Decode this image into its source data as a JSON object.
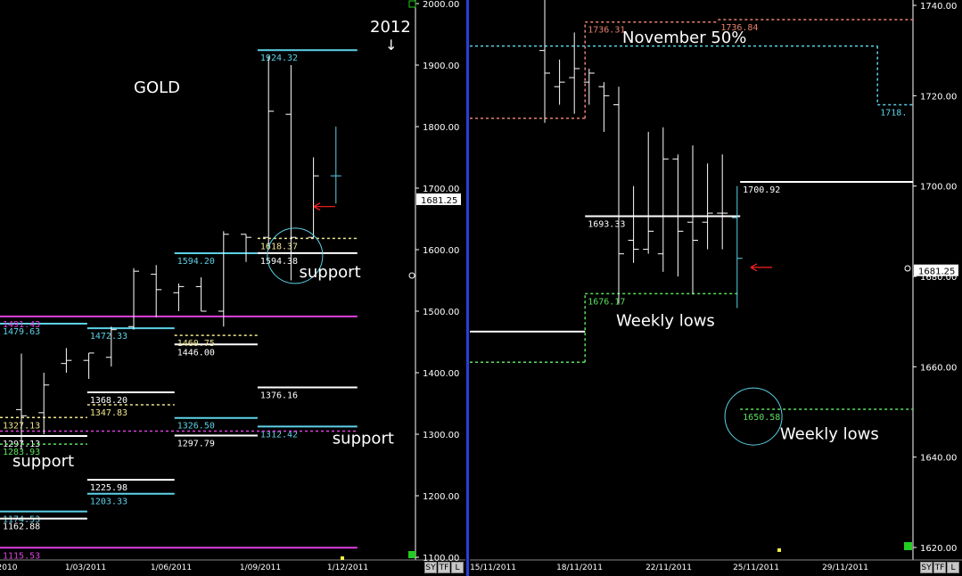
{
  "chart_data": [
    {
      "type": "bar",
      "style": "ohlc-monthly",
      "title": "GOLD",
      "annotation_year": "2012",
      "annotation_arrow": "↓",
      "ylim": [
        1100,
        2000
      ],
      "y_ticks": [
        "2000.00",
        "1900.00",
        "1800.00",
        "1700.00",
        "1600.00",
        "1500.00",
        "1400.00",
        "1300.00",
        "1200.00",
        "1100.00"
      ],
      "x_ticks": [
        "2010",
        "1/03/2011",
        "1/06/2011",
        "1/09/2011",
        "1/12/2011"
      ],
      "current_price": "1681.25",
      "price_color": "#ffffff",
      "bars": [
        {
          "h": 1431,
          "l": 1275,
          "o": 1340,
          "c": 1330
        },
        {
          "h": 1400,
          "l": 1300,
          "o": 1335,
          "c": 1380
        },
        {
          "h": 1440,
          "l": 1400,
          "o": 1415,
          "c": 1420
        },
        {
          "h": 1432,
          "l": 1390,
          "o": 1420,
          "c": 1432
        },
        {
          "h": 1475,
          "l": 1410,
          "o": 1425,
          "c": 1470
        },
        {
          "h": 1570,
          "l": 1470,
          "o": 1475,
          "c": 1565
        },
        {
          "h": 1575,
          "l": 1490,
          "o": 1560,
          "c": 1535
        },
        {
          "h": 1545,
          "l": 1500,
          "o": 1530,
          "c": 1540
        },
        {
          "h": 1555,
          "l": 1500,
          "o": 1540,
          "c": 1500
        },
        {
          "h": 1630,
          "l": 1475,
          "o": 1500,
          "c": 1625
        },
        {
          "h": 1625,
          "l": 1580,
          "o": 1625,
          "c": 1620
        },
        {
          "h": 1915,
          "l": 1600,
          "o": 1620,
          "c": 1825
        },
        {
          "h": 1900,
          "l": 1550,
          "o": 1820,
          "c": 1620
        },
        {
          "h": 1750,
          "l": 1620,
          "o": 1620,
          "c": 1720
        },
        {
          "h": 1800,
          "l": 1675,
          "o": 1720,
          "c": 1720
        }
      ],
      "levels": [
        {
          "label": "1924.32",
          "color": "#5cd2e8",
          "style": "solid",
          "segments": [
            [
              1924.32,
              0.62,
              0.86
            ]
          ]
        },
        {
          "label": "1594.20",
          "color": "#5cd2e8",
          "style": "solid",
          "segments": [
            [
              1594.2,
              0.42,
              0.62
            ]
          ]
        },
        {
          "label": "1472.33",
          "color": "#5cd2e8",
          "style": "solid",
          "segments": [
            [
              1472.33,
              0.21,
              0.42
            ]
          ]
        },
        {
          "label": "1479.63",
          "color": "#5cd2e8",
          "style": "solid",
          "segments": [
            [
              1479.63,
              0.0,
              0.21
            ]
          ]
        },
        {
          "label": "1203.33",
          "color": "#5cd2e8",
          "style": "solid",
          "segments": [
            [
              1203.33,
              0.21,
              0.42
            ]
          ]
        },
        {
          "label": "1326.50",
          "color": "#5cd2e8",
          "style": "solid",
          "segments": [
            [
              1326.5,
              0.42,
              0.62
            ]
          ]
        },
        {
          "label": "1312.42",
          "color": "#5cd2e8",
          "style": "solid",
          "segments": [
            [
              1312.42,
              0.62,
              0.86
            ]
          ]
        },
        {
          "label": "1174.53",
          "color": "#5cd2e8",
          "style": "solid",
          "segments": [
            [
              1174.53,
              0.0,
              0.21
            ]
          ]
        },
        {
          "label": "1594.38",
          "color": "#ffffff",
          "style": "solid",
          "segments": [
            [
              1594.38,
              0.62,
              0.86
            ]
          ]
        },
        {
          "label": "1376.16",
          "color": "#ffffff",
          "style": "solid",
          "segments": [
            [
              1376.16,
              0.62,
              0.86
            ]
          ]
        },
        {
          "label": "1446.00",
          "color": "#ffffff",
          "style": "solid",
          "segments": [
            [
              1446,
              0.42,
              0.62
            ]
          ]
        },
        {
          "label": "1368.20",
          "color": "#ffffff",
          "style": "solid",
          "segments": [
            [
              1368.2,
              0.21,
              0.42
            ]
          ]
        },
        {
          "label": "1297.79",
          "color": "#ffffff",
          "style": "solid",
          "segments": [
            [
              1297.79,
              0.42,
              0.62
            ]
          ]
        },
        {
          "label": "1225.98",
          "color": "#ffffff",
          "style": "solid",
          "segments": [
            [
              1225.98,
              0.21,
              0.42
            ]
          ]
        },
        {
          "label": "1162.88",
          "color": "#ffffff",
          "style": "solid",
          "segments": [
            [
              1162.88,
              0.0,
              0.21
            ]
          ]
        },
        {
          "label": "1297.13",
          "color": "#ffffff",
          "style": "solid",
          "segments": [
            [
              1297.13,
              0.0,
              0.21
            ]
          ]
        },
        {
          "label": "1618.37",
          "color": "#f0e68c",
          "style": "dashed",
          "segments": [
            [
              1618.37,
              0.62,
              0.86
            ]
          ]
        },
        {
          "label": "1460.75",
          "color": "#f0e68c",
          "style": "dashed",
          "segments": [
            [
              1460.75,
              0.42,
              0.62
            ]
          ]
        },
        {
          "label": "1347.83",
          "color": "#f0e68c",
          "style": "dashed",
          "segments": [
            [
              1347.83,
              0.21,
              0.42
            ]
          ]
        },
        {
          "label": "1327.13",
          "color": "#f0e68c",
          "style": "dashed",
          "segments": [
            [
              1327.13,
              0.0,
              0.21
            ]
          ]
        },
        {
          "label": "1491.43",
          "color": "#e040e0",
          "style": "solid",
          "segments": [
            [
              1491.43,
              0.0,
              0.86
            ]
          ]
        },
        {
          "label": "1115.53",
          "color": "#e040e0",
          "style": "solid",
          "segments": [
            [
              1115.53,
              0.0,
              0.86
            ]
          ]
        },
        {
          "label": "1283.93",
          "color": "#5ce05c",
          "style": "dashed",
          "segments": [
            [
              1283.93,
              0.0,
              0.21
            ]
          ]
        },
        {
          "label": "",
          "color": "#e040e0",
          "style": "dashed",
          "segments": [
            [
              1305,
              0.0,
              0.86
            ]
          ]
        }
      ],
      "annotations": [
        {
          "text": "support",
          "v": 1555,
          "xf": 0.72
        },
        {
          "text": "support",
          "v": 1285,
          "xf": 0.8
        },
        {
          "text": "support",
          "v": 1248,
          "xf": 0.03
        }
      ],
      "circle": {
        "v": 1590,
        "xf": 0.71
      },
      "arrow": {
        "v": 1670
      }
    },
    {
      "type": "bar",
      "style": "ohlc-daily",
      "title": "November 50%",
      "annotation_year": "",
      "annotation_arrow": "",
      "ylim": [
        1620,
        1740
      ],
      "y_ticks": [
        "1740.00",
        "1720.00",
        "1700.00",
        "1680.00",
        "1660.00",
        "1640.00",
        "1620.00"
      ],
      "x_ticks": [
        "15/11/2011",
        "18/11/2011",
        "22/11/2011",
        "25/11/2011",
        "29/11/2011"
      ],
      "current_price": "1681.25",
      "price_color": "#ffffff",
      "bars": [
        {
          "h": 1745,
          "l": 1714,
          "o": 1730,
          "c": 1725
        },
        {
          "h": 1728,
          "l": 1718,
          "o": 1722,
          "c": 1723
        },
        {
          "h": 1734,
          "l": 1716,
          "o": 1724,
          "c": 1726
        },
        {
          "h": 1726,
          "l": 1718,
          "o": 1723,
          "c": 1725
        },
        {
          "h": 1723,
          "l": 1712,
          "o": 1722,
          "c": 1720
        },
        {
          "h": 1722,
          "l": 1674,
          "o": 1718,
          "c": 1685
        },
        {
          "h": 1700,
          "l": 1683,
          "o": 1688,
          "c": 1686
        },
        {
          "h": 1712,
          "l": 1685,
          "o": 1686,
          "c": 1690
        },
        {
          "h": 1713,
          "l": 1681,
          "o": 1685,
          "c": 1706
        },
        {
          "h": 1707,
          "l": 1680,
          "o": 1706,
          "c": 1690
        },
        {
          "h": 1709,
          "l": 1676,
          "o": 1692,
          "c": 1688
        },
        {
          "h": 1705,
          "l": 1686,
          "o": 1692,
          "c": 1694
        },
        {
          "h": 1707,
          "l": 1686,
          "o": 1694,
          "c": 1694
        },
        {
          "h": 1700,
          "l": 1673,
          "o": 1693,
          "c": 1684
        }
      ],
      "levels": [
        {
          "label": "1736.31",
          "color": "#e8826e",
          "style": "dashed",
          "segments": [
            [
              1715,
              0.0,
              0.26
            ],
            [
              1736.31,
              0.26,
              0.56
            ]
          ]
        },
        {
          "label": "1736.84",
          "color": "#e8826e",
          "style": "dashed",
          "segments": [
            [
              1736.84,
              0.56,
              1.0
            ]
          ]
        },
        {
          "label": "1718.",
          "color": "#5cd2e8",
          "style": "dashed",
          "segments": [
            [
              1731,
              0.0,
              0.92
            ],
            [
              1718,
              0.92,
              1.0
            ]
          ]
        },
        {
          "label": "1700.92",
          "color": "#ffffff",
          "style": "solid",
          "segments": [
            [
              1700.92,
              0.61,
              1.0
            ]
          ]
        },
        {
          "label": "1693.33",
          "color": "#ffffff",
          "style": "solid",
          "segments": [
            [
              1693.33,
              0.26,
              0.61
            ]
          ]
        },
        {
          "label": "",
          "color": "#ffffff",
          "style": "solid",
          "segments": [
            [
              1667.8,
              0.0,
              0.26
            ]
          ]
        },
        {
          "label": "1676.17",
          "color": "#5ce05c",
          "style": "dashed",
          "segments": [
            [
              1661,
              0.0,
              0.26
            ],
            [
              1676.17,
              0.26,
              0.61
            ]
          ]
        },
        {
          "label": "1650.58",
          "color": "#5ce05c",
          "style": "dashed",
          "segments": [
            [
              1650.58,
              0.61,
              1.0
            ]
          ]
        }
      ],
      "annotations": [
        {
          "text": "Weekly  lows",
          "v": 1669,
          "xf": 0.33
        },
        {
          "text": "Weekly  lows",
          "v": 1644,
          "xf": 0.7
        }
      ],
      "circle": {
        "v": 1649,
        "xf": 0.64
      },
      "arrow": {
        "v": 1682
      }
    }
  ],
  "toolbar": {
    "buttons": [
      "SY",
      "TF",
      "L"
    ]
  },
  "colors": {
    "background": "#000000",
    "axis": "#ffffff",
    "divider": "#2b3fd6",
    "bar": "#ffffff",
    "bar_current": "#5cd2e8",
    "arrow": "#ff2020",
    "circle": "#5cd2e8",
    "title": "#ffffff"
  }
}
